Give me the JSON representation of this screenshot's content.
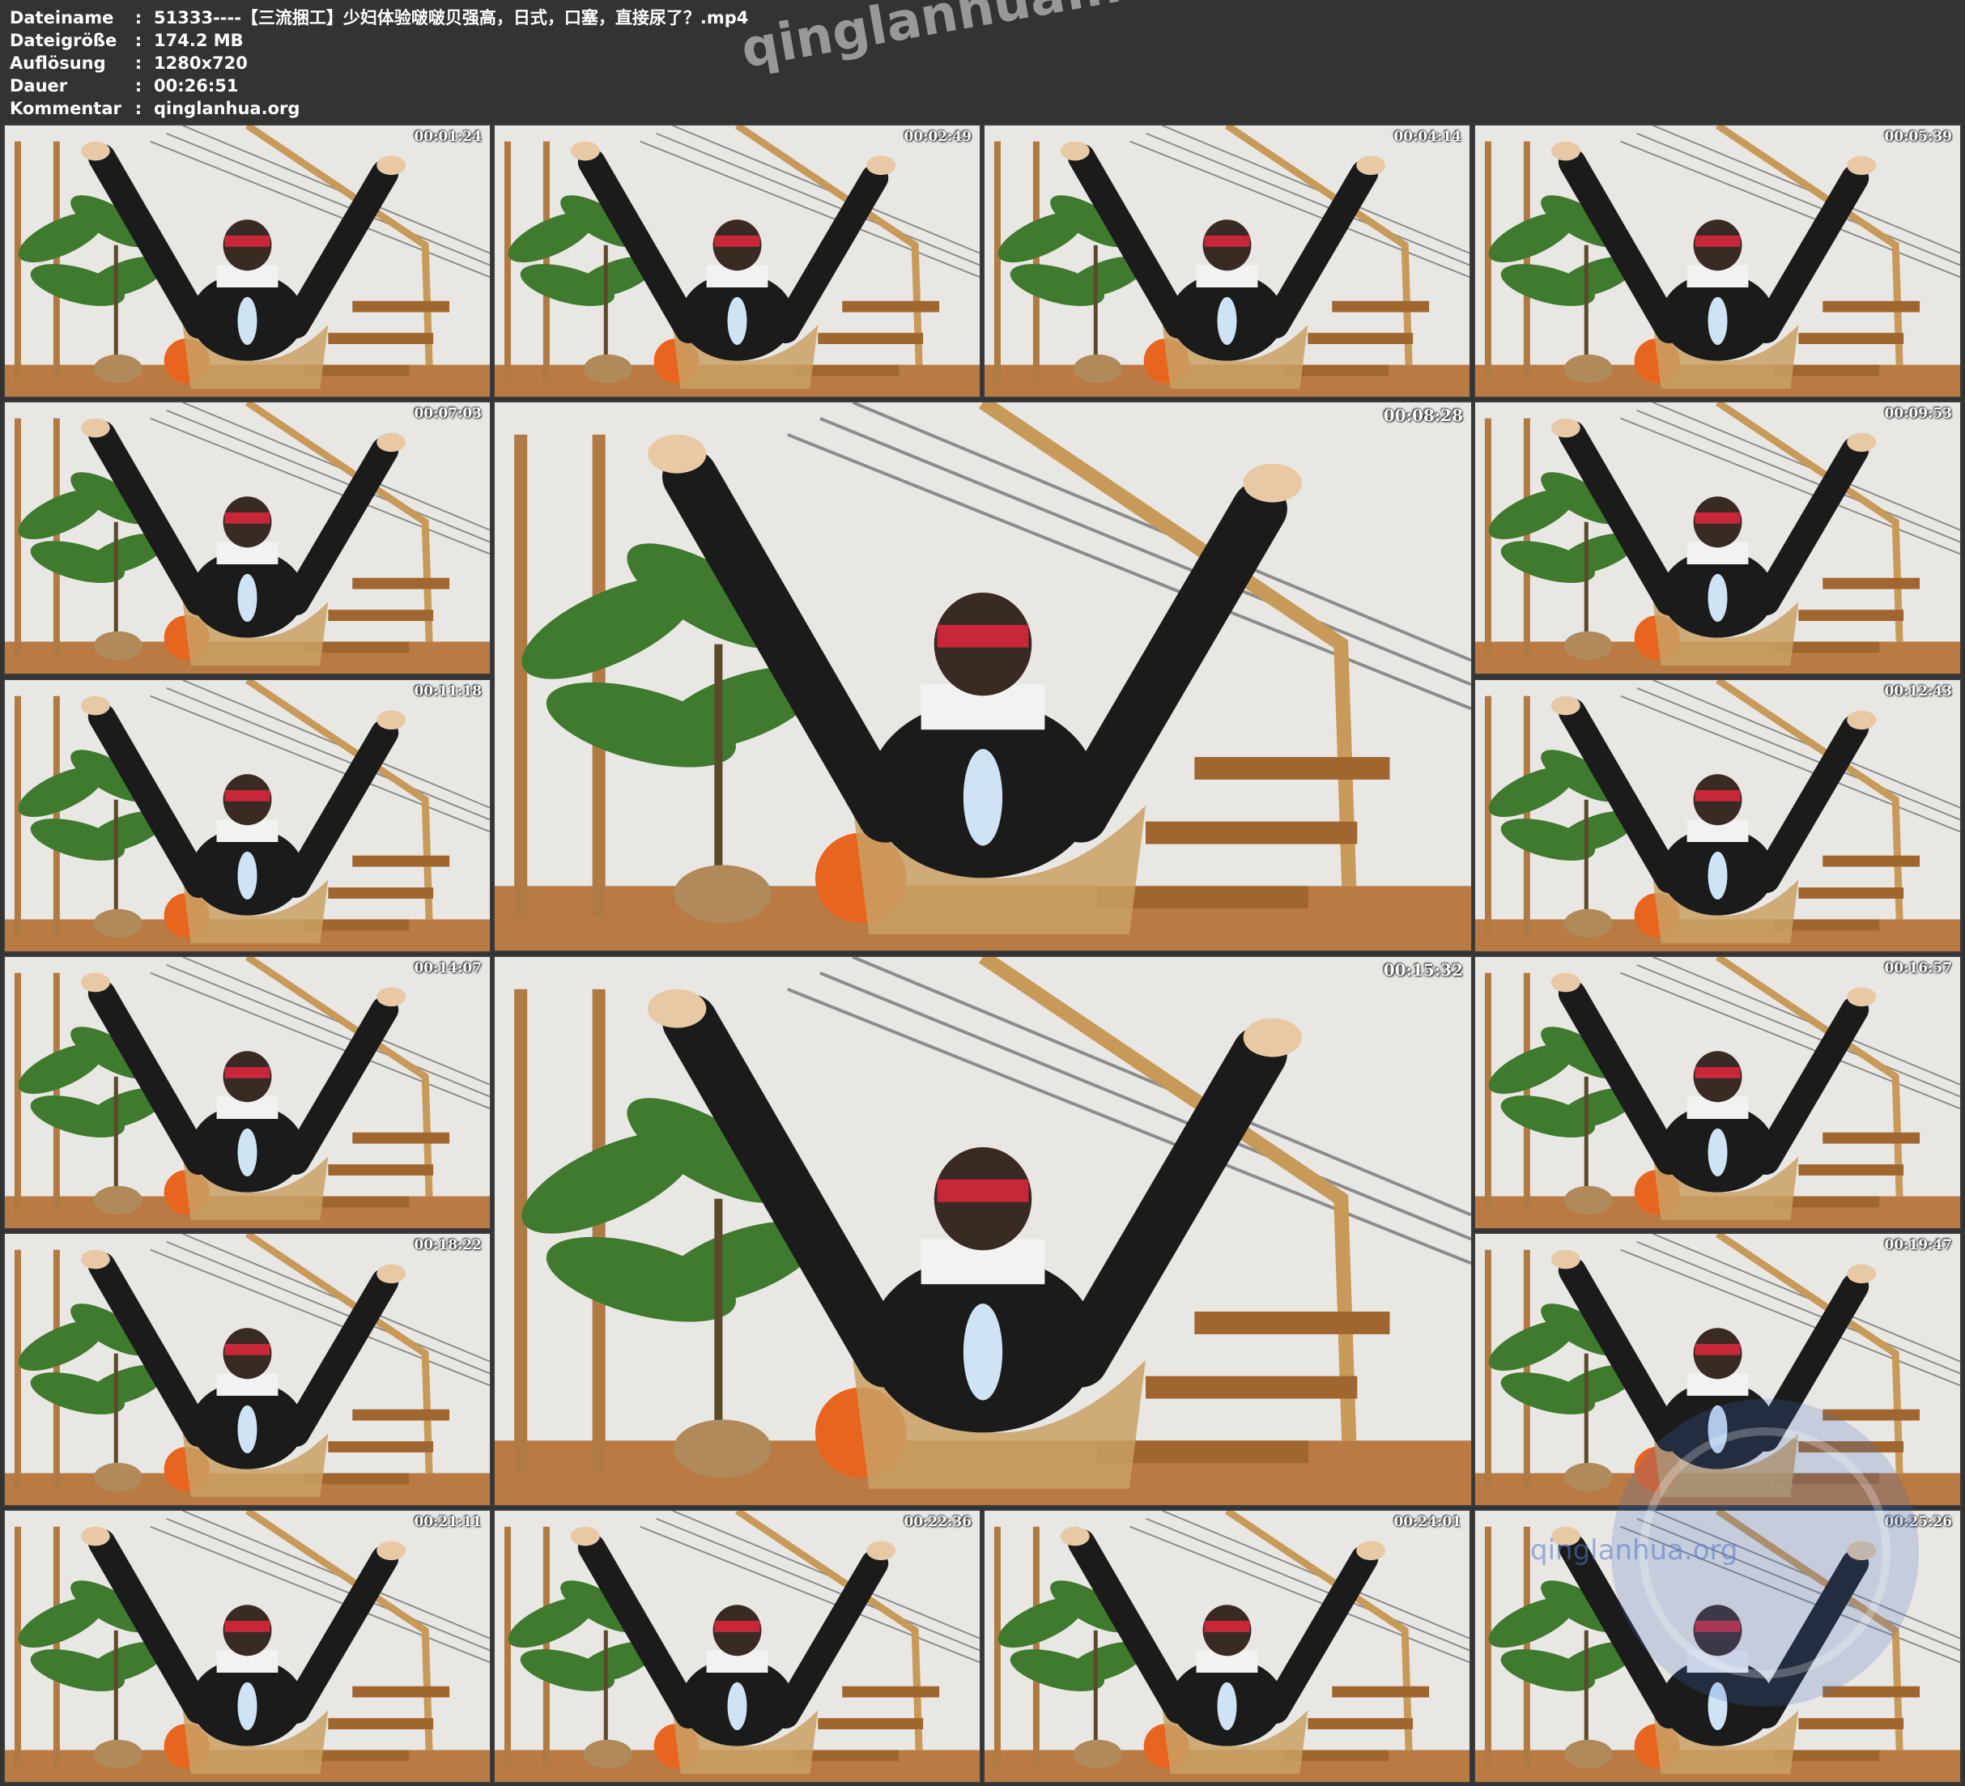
{
  "header": {
    "rows": [
      {
        "label": "Dateiname",
        "value": "51333----【三流捆工】少妇体验啵啵贝强高，日式，口塞，直接尿了？.mp4"
      },
      {
        "label": "Dateigröße",
        "value": "174.2 MB"
      },
      {
        "label": "Auflösung",
        "value": "1280x720"
      },
      {
        "label": "Dauer",
        "value": "00:26:51"
      },
      {
        "label": "Kommentar",
        "value": "qinglanhua.org"
      }
    ],
    "separator": ":"
  },
  "watermark": "qinglanhua.net",
  "corner_logo_text": "qinglanhua.org",
  "thumbnails": [
    {
      "timestamp": "00:01:24"
    },
    {
      "timestamp": "00:02:49"
    },
    {
      "timestamp": "00:04:14"
    },
    {
      "timestamp": "00:05:39"
    },
    {
      "timestamp": "00:07:03"
    },
    {
      "timestamp": "00:08:28"
    },
    {
      "timestamp": "00:09:53"
    },
    {
      "timestamp": "00:11:18"
    },
    {
      "timestamp": "00:12:43"
    },
    {
      "timestamp": "00:14:07"
    },
    {
      "timestamp": "00:15:32"
    },
    {
      "timestamp": "00:16:57"
    },
    {
      "timestamp": "00:18:22"
    },
    {
      "timestamp": "00:19:47"
    },
    {
      "timestamp": "00:21:11"
    },
    {
      "timestamp": "00:22:36"
    },
    {
      "timestamp": "00:24:01"
    },
    {
      "timestamp": "00:25:26"
    }
  ],
  "colors": {
    "background": "#333333",
    "wall": "#e9e7e4",
    "floor": "#b97a43",
    "plant": "#3f7a2e",
    "legs": "#1b1b1b",
    "chair": "#c9a064",
    "ball": "#e8651f"
  }
}
